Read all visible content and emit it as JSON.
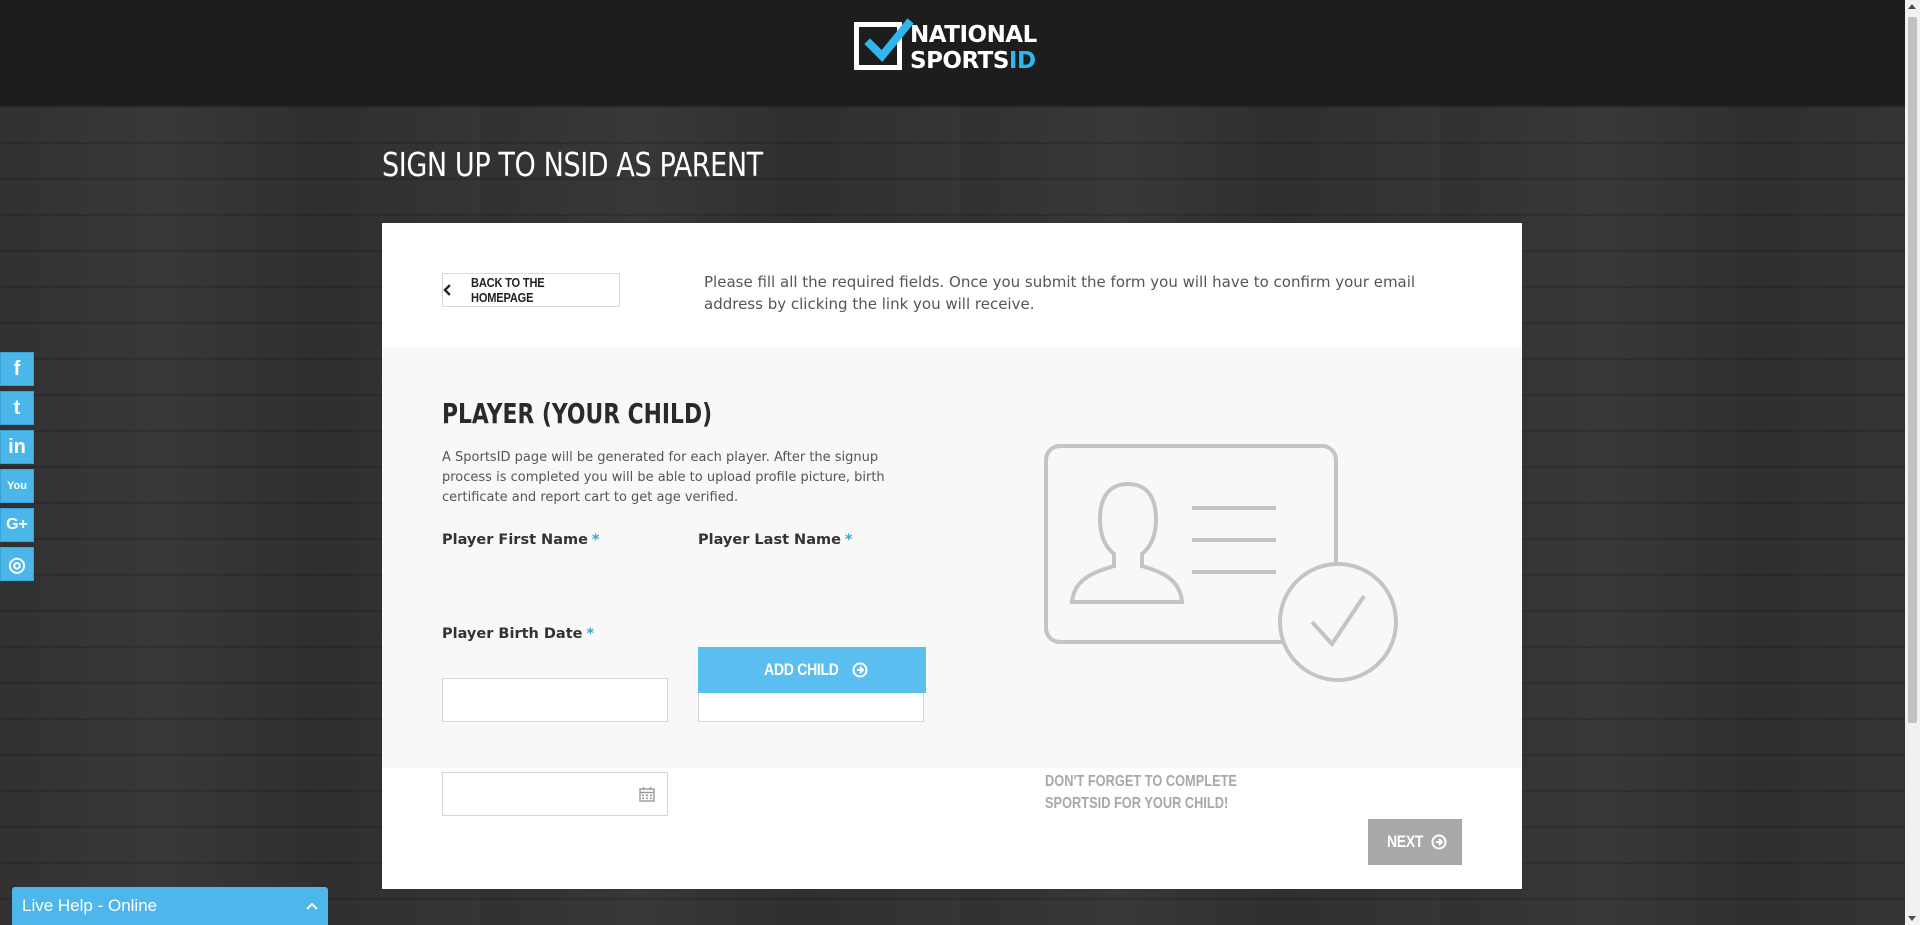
{
  "brand": {
    "logo_line1": "NATIONAL",
    "logo_line2_a": "SPORTS",
    "logo_line2_b": "ID",
    "accent": "#2fb6ee"
  },
  "page": {
    "title": "SIGN UP TO NSID AS PARENT"
  },
  "intro": {
    "back_label": "BACK TO THE HOMEPAGE",
    "text": "Please fill all the required fields. Once you submit the form you will have to confirm your email address by clicking the link you will receive."
  },
  "player_section": {
    "title": "PLAYER (YOUR CHILD)",
    "description": "A SportsID page will be generated for each player. After the signup process is completed you will be able to upload profile picture, birth certificate and report cart to get age verified.",
    "first_name_label": "Player First Name",
    "last_name_label": "Player Last Name",
    "birth_date_label": "Player Birth Date",
    "required_mark": "*",
    "first_name_value": "",
    "last_name_value": "",
    "birth_date_value": "",
    "add_child_label": "ADD CHILD",
    "reminder": "DON'T FORGET TO COMPLETE SPORTSID FOR YOUR CHILD!"
  },
  "footer": {
    "next_label": "NEXT"
  },
  "social": [
    "facebook-icon",
    "twitter-icon",
    "linkedin-icon",
    "youtube-icon",
    "google-plus-icon",
    "instagram-icon"
  ],
  "social_glyphs": [
    "f",
    "t",
    "in",
    "You",
    "G+",
    "◎"
  ],
  "livehelp": {
    "label": "Live Help - Online"
  },
  "colors": {
    "button_blue": "#5bbef0",
    "next_gray": "#a9a9a9",
    "header_bg": "#1d1d1d"
  }
}
